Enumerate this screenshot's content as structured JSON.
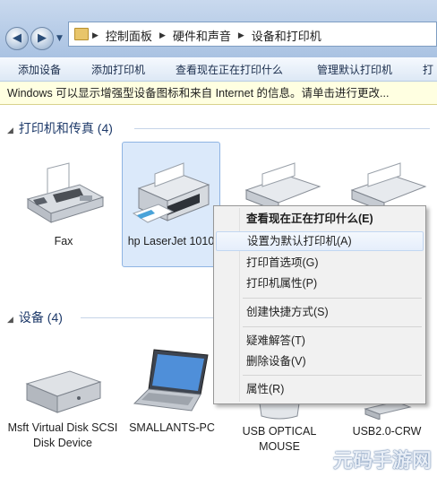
{
  "breadcrumb": [
    "控制面板",
    "硬件和声音",
    "设备和打印机"
  ],
  "commands": [
    "添加设备",
    "添加打印机",
    "查看现在正在打印什么",
    "管理默认打印机",
    "打"
  ],
  "info_bar": "Windows 可以显示增强型设备图标和来自 Internet 的信息。请单击进行更改...",
  "groups": {
    "printers": {
      "header": "打印机和传真 (4)",
      "items": [
        {
          "label": "Fax"
        },
        {
          "label": "hp LaserJet 1010"
        },
        {
          "label": ""
        },
        {
          "label": ""
        }
      ]
    },
    "devices": {
      "header": "设备 (4)",
      "items": [
        {
          "label": "Msft Virtual Disk SCSI Disk Device"
        },
        {
          "label": "SMALLANTS-PC"
        },
        {
          "label": "USB OPTICAL MOUSE"
        },
        {
          "label": "USB2.0-CRW"
        }
      ]
    }
  },
  "context_menu": {
    "items": [
      {
        "label": "查看现在正在打印什么(E)",
        "bold": true
      },
      {
        "label": "设置为默认打印机(A)",
        "highlighted": true
      },
      {
        "label": "打印首选项(G)"
      },
      {
        "label": "打印机属性(P)"
      },
      {
        "label": "创建快捷方式(S)"
      },
      {
        "label": "疑难解答(T)"
      },
      {
        "label": "删除设备(V)"
      },
      {
        "label": "属性(R)"
      }
    ]
  },
  "watermark": "元码手游网",
  "colors": {
    "accent": "#1e3a6a",
    "selection": "#dbe9fa",
    "info_bar": "#ffffe1"
  }
}
